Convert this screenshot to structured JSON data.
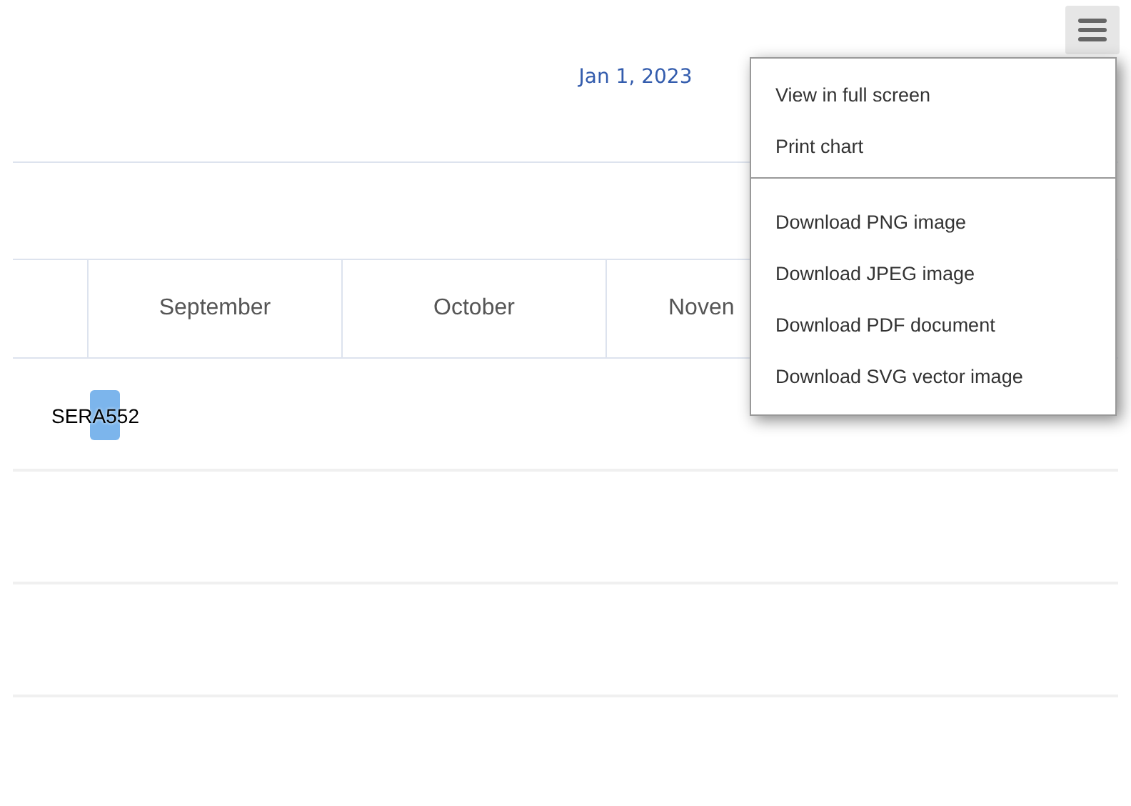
{
  "chart": {
    "title": "Jan 1, 2023",
    "columns": [
      {
        "label": "September"
      },
      {
        "label": "October"
      },
      {
        "label": "Noven"
      }
    ],
    "tasks": [
      {
        "name": "SERA552",
        "color": "#7cb5ec"
      }
    ]
  },
  "export_menu": {
    "expanded": true,
    "items": [
      {
        "label": "View in full screen",
        "kind": "item"
      },
      {
        "label": "Print chart",
        "kind": "item"
      },
      {
        "kind": "separator"
      },
      {
        "label": "Download PNG image",
        "kind": "item"
      },
      {
        "label": "Download JPEG image",
        "kind": "item"
      },
      {
        "label": "Download PDF document",
        "kind": "item"
      },
      {
        "label": "Download SVG vector image",
        "kind": "item"
      }
    ]
  }
}
